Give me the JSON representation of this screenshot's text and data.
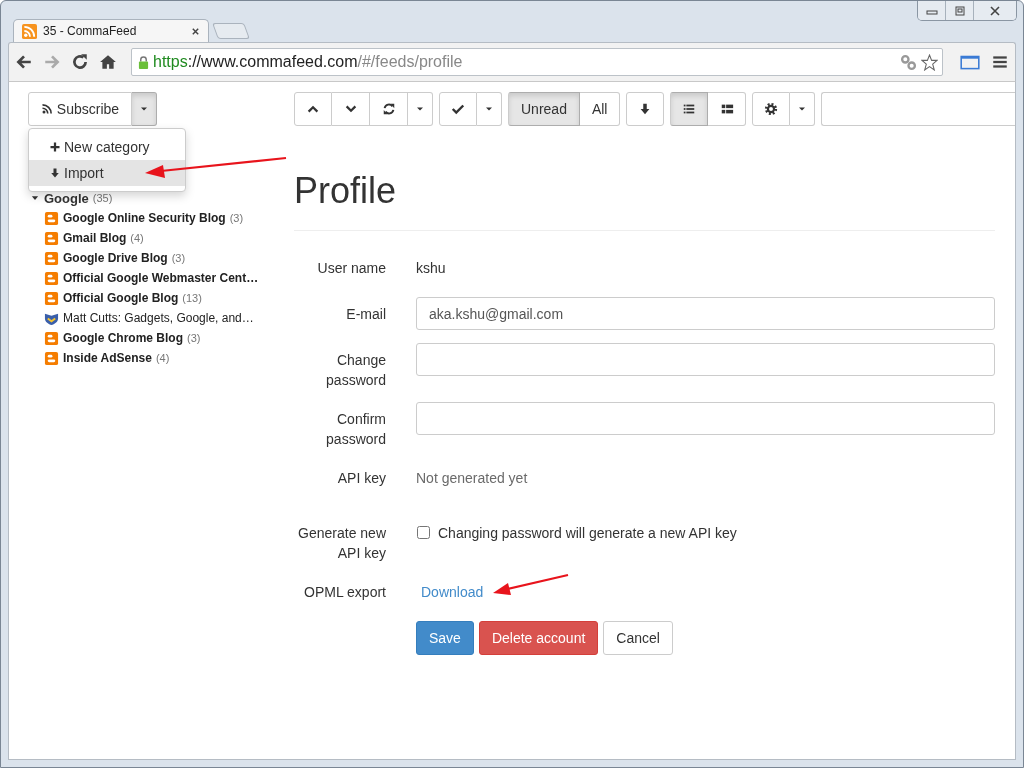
{
  "browser": {
    "tab_title": "35 - CommaFeed",
    "url": {
      "scheme": "https",
      "host": "://www.commafeed.com",
      "path": "/#/feeds/profile"
    }
  },
  "toolbar": {
    "subscribe": {
      "label": "Subscribe"
    },
    "groups": [
      {
        "buttons": [
          {
            "kind": "up"
          },
          {
            "kind": "down"
          },
          {
            "kind": "refresh"
          },
          {
            "kind": "caret"
          }
        ]
      },
      {
        "buttons": [
          {
            "kind": "check"
          },
          {
            "kind": "caret"
          }
        ]
      },
      {
        "buttons": [
          {
            "kind": "text",
            "label": "Unread",
            "selected": true
          },
          {
            "kind": "text",
            "label": "All",
            "selected": false
          }
        ]
      },
      {
        "buttons": [
          {
            "kind": "mark-read"
          }
        ]
      },
      {
        "buttons": [
          {
            "kind": "list",
            "selected": true
          },
          {
            "kind": "expanded",
            "selected": false
          }
        ]
      },
      {
        "buttons": [
          {
            "kind": "settings"
          },
          {
            "kind": "caret"
          }
        ]
      }
    ]
  },
  "subscribe_menu": {
    "items": [
      {
        "kind": "add",
        "label": "New category",
        "hovered": false
      },
      {
        "kind": "import",
        "label": "Import",
        "hovered": true
      }
    ]
  },
  "sidebar": {
    "categories": [
      {
        "name": "Google",
        "count": "(35)",
        "expanded": true,
        "feeds": [
          {
            "kind": "blogger",
            "name": "Google Online Security Blog",
            "count": "(3)",
            "unread": true
          },
          {
            "kind": "blogger",
            "name": "Gmail Blog",
            "count": "(4)",
            "unread": true
          },
          {
            "kind": "blogger",
            "name": "Google Drive Blog",
            "count": "(3)",
            "unread": true
          },
          {
            "kind": "blogger",
            "name": "Official Google Webmaster Cent…",
            "unread": true
          },
          {
            "kind": "blogger",
            "name": "Official Google Blog",
            "count": "(13)",
            "unread": true
          },
          {
            "kind": "site",
            "name": "Matt Cutts: Gadgets, Google, and…",
            "unread": false
          },
          {
            "kind": "blogger",
            "name": "Google Chrome Blog",
            "count": "(3)",
            "unread": true
          },
          {
            "kind": "blogger",
            "name": "Inside AdSense",
            "count": "(4)",
            "unread": true
          }
        ]
      }
    ]
  },
  "profile": {
    "title": "Profile",
    "rows": [
      {
        "kind": "text",
        "label": "User name",
        "value": "kshu"
      },
      {
        "kind": "input",
        "label": "E-mail",
        "value": "aka.kshu@gmail.com"
      },
      {
        "kind": "input",
        "label": "Change password"
      },
      {
        "kind": "input",
        "label": "Confirm password"
      },
      {
        "kind": "note",
        "label": "API key",
        "value": "Not generated yet"
      },
      {
        "kind": "checkbox",
        "label": "Generate new API key",
        "text": "Changing password will generate a new API key",
        "checked": false
      },
      {
        "kind": "link",
        "label": "OPML export",
        "value": "Download"
      }
    ],
    "buttons": [
      {
        "kind": "primary",
        "label": "Save"
      },
      {
        "kind": "danger",
        "label": "Delete account"
      },
      {
        "kind": "default",
        "label": "Cancel"
      }
    ]
  }
}
